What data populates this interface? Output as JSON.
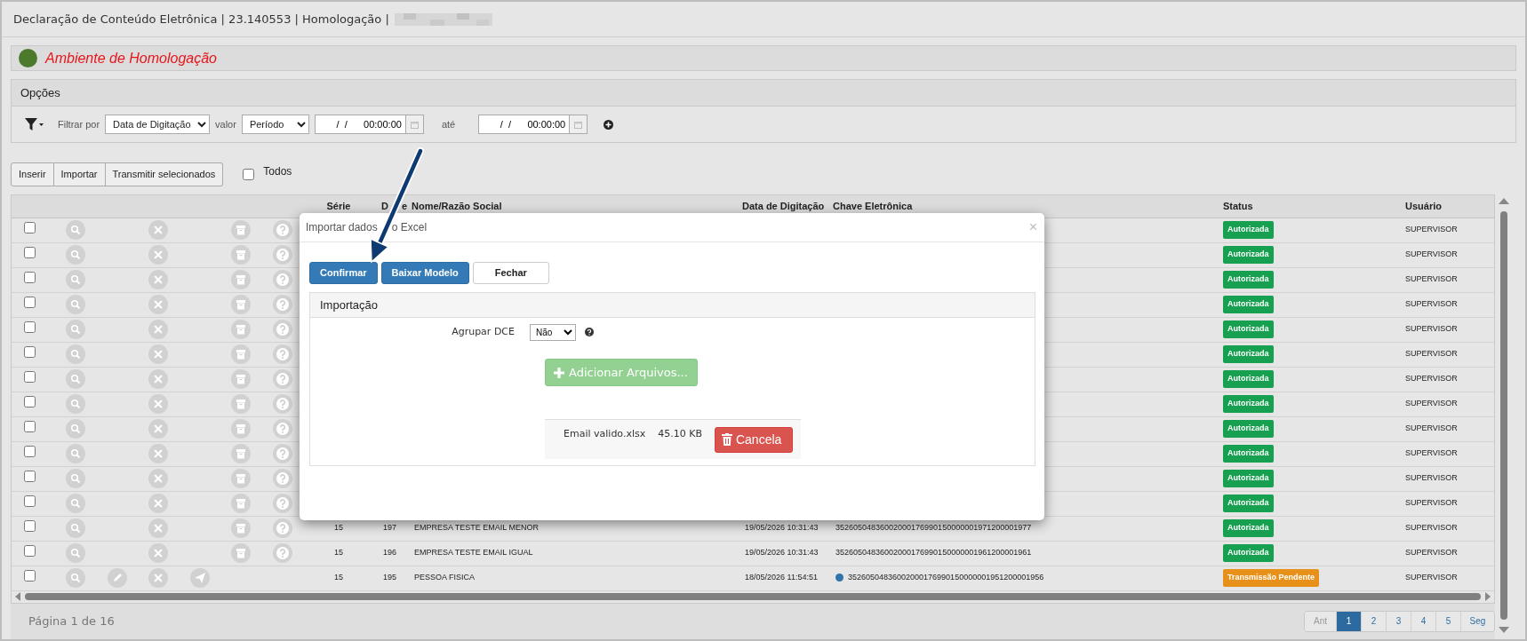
{
  "window": {
    "title": "Declaração de Conteúdo Eletrônica | 23.140553 | Homologação |"
  },
  "environment": {
    "label": "Ambiente de Homologação"
  },
  "options": {
    "title": "Opções",
    "filter_label": "Filtrar por",
    "filter_field": "Data de Digitação",
    "value_label": "valor",
    "value_mode": "Período",
    "from_value": "  /  /      00:00:00",
    "until_label": "até",
    "until_value": "  /  /      00:00:00"
  },
  "toolbar": {
    "buttons": [
      "Inserir",
      "Importar",
      "Transmitir selecionados"
    ],
    "select_all": {
      "label": "Todos",
      "checked": false
    }
  },
  "table": {
    "columns": [
      "Série",
      {
        "parts": [
          "D",
          "e"
        ]
      },
      "Nome/Razão Social",
      "Data de Digitação",
      "Chave Eletrônica",
      "Status",
      "Usuário"
    ],
    "rows": [
      {
        "checked": false,
        "actions": [
          {
            "kind": "search"
          },
          {
            "kind": "cancel"
          },
          {
            "kind": "archive"
          },
          {
            "kind": "help"
          }
        ],
        "status": {
          "text": "Autorizada",
          "color": "#16a050"
        },
        "user": "SUPERVISOR"
      },
      {
        "checked": false,
        "actions": [
          {
            "kind": "search"
          },
          {
            "kind": "cancel"
          },
          {
            "kind": "archive"
          },
          {
            "kind": "help"
          }
        ],
        "status": {
          "text": "Autorizada",
          "color": "#16a050"
        },
        "user": "SUPERVISOR"
      },
      {
        "checked": false,
        "actions": [
          {
            "kind": "search"
          },
          {
            "kind": "cancel"
          },
          {
            "kind": "archive"
          },
          {
            "kind": "help"
          }
        ],
        "status": {
          "text": "Autorizada",
          "color": "#16a050"
        },
        "user": "SUPERVISOR"
      },
      {
        "checked": false,
        "actions": [
          {
            "kind": "search"
          },
          {
            "kind": "cancel"
          },
          {
            "kind": "archive"
          },
          {
            "kind": "help"
          }
        ],
        "status": {
          "text": "Autorizada",
          "color": "#16a050"
        },
        "user": "SUPERVISOR"
      },
      {
        "checked": false,
        "actions": [
          {
            "kind": "search"
          },
          {
            "kind": "cancel"
          },
          {
            "kind": "archive"
          },
          {
            "kind": "help"
          }
        ],
        "status": {
          "text": "Autorizada",
          "color": "#16a050"
        },
        "user": "SUPERVISOR"
      },
      {
        "checked": false,
        "actions": [
          {
            "kind": "search"
          },
          {
            "kind": "cancel"
          },
          {
            "kind": "archive"
          },
          {
            "kind": "help"
          }
        ],
        "status": {
          "text": "Autorizada",
          "color": "#16a050"
        },
        "user": "SUPERVISOR"
      },
      {
        "checked": false,
        "actions": [
          {
            "kind": "search"
          },
          {
            "kind": "cancel"
          },
          {
            "kind": "archive"
          },
          {
            "kind": "help"
          }
        ],
        "status": {
          "text": "Autorizada",
          "color": "#16a050"
        },
        "user": "SUPERVISOR"
      },
      {
        "checked": false,
        "actions": [
          {
            "kind": "search"
          },
          {
            "kind": "cancel"
          },
          {
            "kind": "archive"
          },
          {
            "kind": "help"
          }
        ],
        "status": {
          "text": "Autorizada",
          "color": "#16a050"
        },
        "user": "SUPERVISOR"
      },
      {
        "checked": false,
        "actions": [
          {
            "kind": "search"
          },
          {
            "kind": "cancel"
          },
          {
            "kind": "archive"
          },
          {
            "kind": "help"
          }
        ],
        "status": {
          "text": "Autorizada",
          "color": "#16a050"
        },
        "user": "SUPERVISOR"
      },
      {
        "checked": false,
        "actions": [
          {
            "kind": "search"
          },
          {
            "kind": "cancel"
          },
          {
            "kind": "archive"
          },
          {
            "kind": "help"
          }
        ],
        "status": {
          "text": "Autorizada",
          "color": "#16a050"
        },
        "user": "SUPERVISOR"
      },
      {
        "checked": false,
        "actions": [
          {
            "kind": "search"
          },
          {
            "kind": "cancel"
          },
          {
            "kind": "archive"
          },
          {
            "kind": "help"
          }
        ],
        "status": {
          "text": "Autorizada",
          "color": "#16a050"
        },
        "user": "SUPERVISOR"
      },
      {
        "checked": false,
        "actions": [
          {
            "kind": "search"
          },
          {
            "kind": "cancel"
          },
          {
            "kind": "archive"
          },
          {
            "kind": "help"
          }
        ],
        "status": {
          "text": "Autorizada",
          "color": "#16a050"
        },
        "user": "SUPERVISOR"
      },
      {
        "checked": false,
        "actions": [
          {
            "kind": "search"
          },
          {
            "kind": "cancel"
          },
          {
            "kind": "archive"
          },
          {
            "kind": "help"
          }
        ],
        "serie": "15",
        "number": "197",
        "name": "EMPRESA TESTE EMAIL MENOR",
        "date": "19/05/2026 10:31:43",
        "key": "35260504836002000176990150000001971200001977",
        "flagged": false,
        "status": {
          "text": "Autorizada",
          "color": "#16a050"
        },
        "user": "SUPERVISOR"
      },
      {
        "checked": false,
        "actions": [
          {
            "kind": "search"
          },
          {
            "kind": "cancel"
          },
          {
            "kind": "archive"
          },
          {
            "kind": "help"
          }
        ],
        "serie": "15",
        "number": "196",
        "name": "EMPRESA TESTE EMAIL IGUAL",
        "date": "19/05/2026 10:31:43",
        "key": "35260504836002000176990150000001961200001961",
        "flagged": false,
        "status": {
          "text": "Autorizada",
          "color": "#16a050"
        },
        "user": "SUPERVISOR"
      },
      {
        "checked": false,
        "actions": [
          {
            "kind": "search"
          },
          {
            "kind": "edit"
          },
          {
            "kind": "cancel"
          },
          {
            "kind": "send"
          }
        ],
        "serie": "15",
        "number": "195",
        "name": "PESSOA FISICA",
        "date": "18/05/2026 11:54:51",
        "key": "35260504836002000176990150000001951200001956",
        "flagged": true,
        "status": {
          "text": "Transmissão Pendente",
          "color": "#e8911a"
        },
        "user": "SUPERVISOR"
      }
    ]
  },
  "pagination": {
    "label": "Página 1 de 16",
    "prev": "Ant",
    "pages": [
      {
        "label": "1",
        "selected": true
      },
      {
        "label": "2",
        "selected": false
      },
      {
        "label": "3",
        "selected": false
      },
      {
        "label": "4",
        "selected": false
      },
      {
        "label": "5",
        "selected": false
      }
    ],
    "next": "Seg"
  },
  "dialog": {
    "title_parts": [
      "Importar dados",
      "o Excel"
    ],
    "close": "×",
    "buttons": [
      {
        "label": "Confirmar",
        "kind": "primary"
      },
      {
        "label": "Baixar Modelo",
        "kind": "primary"
      },
      {
        "label": "Fechar",
        "kind": "default"
      }
    ],
    "panel": {
      "title": "Importação",
      "group_label": "Agrupar DCE",
      "group_value": "Não",
      "add_button": "Adicionar Arquivos...",
      "add_disabled": true,
      "files": [
        {
          "name": "Email valido.xlsx",
          "size": "45.10 KB",
          "cancel": "Cancela"
        }
      ]
    }
  }
}
